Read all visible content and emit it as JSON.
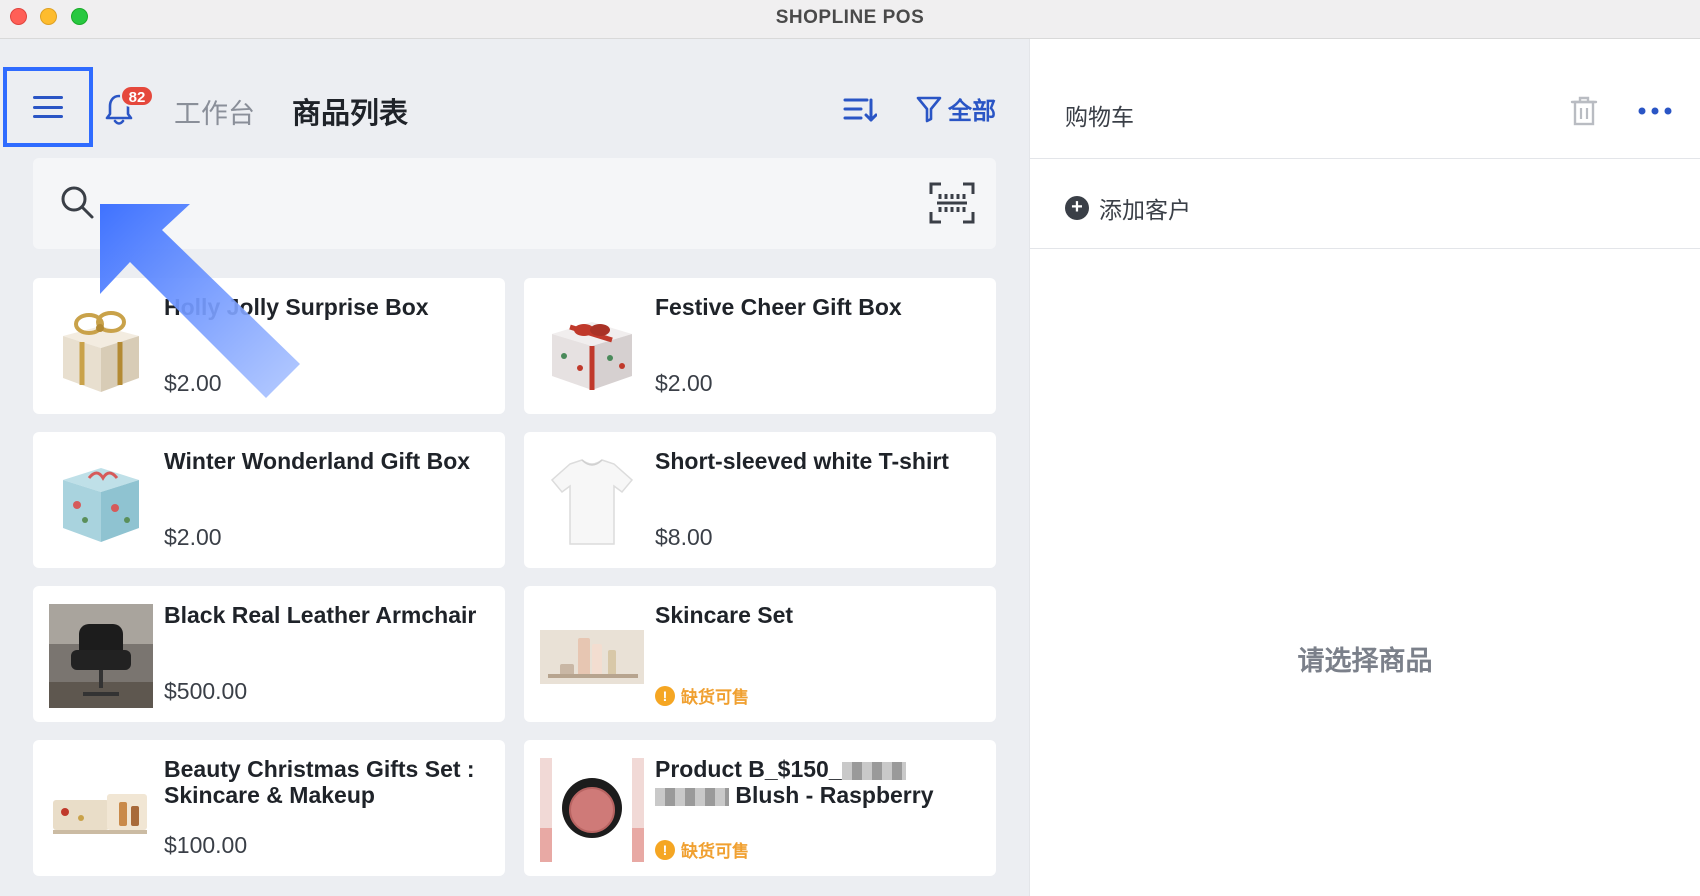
{
  "window": {
    "title": "SHOPLINE POS"
  },
  "header": {
    "notification_count": "82",
    "nav_workbench": "工作台",
    "nav_products": "商品列表",
    "filter_label": "全部"
  },
  "search": {
    "placeholder": ""
  },
  "products": [
    {
      "name": "Holly Jolly Surprise Box",
      "price": "$2.00",
      "status": "",
      "image": "gold-ribbon-gift-box"
    },
    {
      "name": "Festive Cheer Gift Box",
      "price": "$2.00",
      "status": "",
      "image": "red-ribbon-gift-box"
    },
    {
      "name": "Winter Wonderland Gift Box",
      "price": "$2.00",
      "status": "",
      "image": "blue-gift-box"
    },
    {
      "name": "Short-sleeved white T-shirt",
      "price": "$8.00",
      "status": "",
      "image": "white-tshirt"
    },
    {
      "name": "Black Real Leather Armchair",
      "price": "$500.00",
      "status": "",
      "image": "leather-armchair"
    },
    {
      "name": "Skincare Set",
      "price": "",
      "status": "缺货可售",
      "image": "skincare-bottles"
    },
    {
      "name": "Beauty Christmas Gifts Set : Skincare & Makeup",
      "price": "$100.00",
      "status": "",
      "image": "christmas-gift-set"
    },
    {
      "name_part1": "Product B_$150_",
      "name_part2": " Blush - Raspberry",
      "price": "",
      "status": "缺货可售",
      "image": "blush-compact"
    }
  ],
  "cart": {
    "title": "购物车",
    "add_customer": "添加客户",
    "empty_message": "请选择商品"
  },
  "colors": {
    "accent": "#2a55c5",
    "highlight_border": "#2f6bff",
    "badge": "#e5483c",
    "out_of_stock": "#f0a030",
    "pane_bg": "#eceef2"
  }
}
